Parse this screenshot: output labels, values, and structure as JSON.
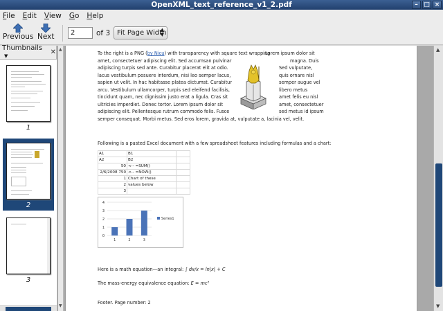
{
  "window": {
    "title": "OpenXML_text_reference_v1_2.pdf"
  },
  "menu": [
    "File",
    "Edit",
    "View",
    "Go",
    "Help"
  ],
  "toolbar": {
    "previous_label": "Previous",
    "next_label": "Next",
    "page_value": "2",
    "page_of": "of 3",
    "zoom": "Fit Page Width"
  },
  "sidebar": {
    "header": "Thumbnails",
    "thumbs": [
      {
        "label": "1"
      },
      {
        "label": "2"
      },
      {
        "label": "3"
      }
    ],
    "selected_index": 1
  },
  "document": {
    "para1_line1_pre": "To the right is a PNG (",
    "para1_link": "by Nicu",
    "para1_line1_post": ") with transparency with square text wrapping.",
    "para1_col_right": [
      "Lorem ipsum dolor sit",
      "magna. Duis",
      "Sed vulputate,",
      "quis ornare nisl",
      "semper augue vel",
      "libero metus",
      "amet felis eu nisl",
      "amet, consectetuer",
      "sed metus id ipsum"
    ],
    "para1_col_left": [
      "amet, consectetuer adipiscing elit. Sed accumsan pulvinar",
      "adipiscing turpis sed ante. Curabitur placerat elit at odio.",
      "lacus vestibulum posuere interdum, nisi leo semper lacus,",
      "sapien ut velit. In hac habitasse platea dictumst. Curabitur",
      "arcu. Vestibulum ullamcorper, turpis sed eleifend facilisis,",
      "tincidunt quam, nec dignissim justo erat a ligula. Cras sit",
      "ultricies imperdiet. Donec tortor. Lorem ipsum dolor sit",
      "adipiscing elit. Pellentesque rutrum commodo felis. Fusce"
    ],
    "para1_last": "semper consequat. Morbi metus. Sed eros lorem, gravida at, vulputate a, lacinia vel, velit.",
    "para2": "Following is a pasted Excel document with a few spreadsheet features including formulas and a chart:",
    "sheet_rows": [
      [
        "A1",
        "B1"
      ],
      [
        "A2",
        "B2"
      ],
      [
        "50",
        "<-- =SUM()"
      ],
      [
        "2/6/2008 750",
        "<-- =NOW()"
      ],
      [
        "1",
        "Chart of these"
      ],
      [
        "2",
        "values below"
      ],
      [
        "3",
        ""
      ]
    ],
    "math_text": "Here is a math equation—an integral:",
    "math_formula": "∫ dx/x = ln|x| + C",
    "energy_text": "The mass-energy equivalence equation:",
    "energy_formula": "E = mc²",
    "footer": "Footer.  Page number: 2"
  },
  "chart_data": {
    "type": "bar",
    "categories": [
      "1",
      "2",
      "3"
    ],
    "series": [
      {
        "name": "Series1",
        "values": [
          1,
          2,
          3
        ]
      }
    ],
    "ylim": [
      0,
      4
    ],
    "yticks": [
      "0",
      "1",
      "2",
      "3",
      "4"
    ],
    "legend": "right",
    "color": "#4a73b8"
  }
}
